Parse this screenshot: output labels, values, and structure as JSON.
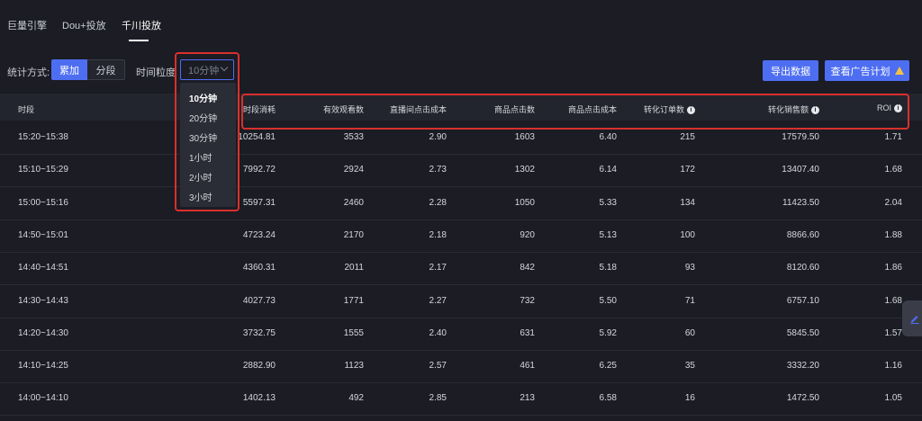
{
  "tabs": [
    {
      "label": "巨量引擎"
    },
    {
      "label": "Dou+投放"
    },
    {
      "label": "千川投放"
    }
  ],
  "controls": {
    "stat_mode_label": "统计方式:",
    "stat_mode_options": [
      "累加",
      "分段"
    ],
    "granularity_label": "时间粒度",
    "granularity_value": "10分钟",
    "granularity_options": [
      "10分钟",
      "20分钟",
      "30分钟",
      "1小时",
      "2小时",
      "3小时"
    ],
    "export_label": "导出数据",
    "view_plan_label": "查看广告计划"
  },
  "table": {
    "headers": [
      "时段",
      "时段消耗",
      "有效观看数",
      "直播间点击成本",
      "商品点击数",
      "商品点击成本",
      "转化订单数",
      "转化销售额",
      "ROI"
    ],
    "info_headers": [
      "转化订单数",
      "转化销售额",
      "ROI"
    ],
    "rows": [
      [
        "15:20~15:38",
        "10254.81",
        "3533",
        "2.90",
        "1603",
        "6.40",
        "215",
        "17579.50",
        "1.71"
      ],
      [
        "15:10~15:29",
        "7992.72",
        "2924",
        "2.73",
        "1302",
        "6.14",
        "172",
        "13407.40",
        "1.68"
      ],
      [
        "15:00~15:16",
        "5597.31",
        "2460",
        "2.28",
        "1050",
        "5.33",
        "134",
        "11423.50",
        "2.04"
      ],
      [
        "14:50~15:01",
        "4723.24",
        "2170",
        "2.18",
        "920",
        "5.13",
        "100",
        "8866.60",
        "1.88"
      ],
      [
        "14:40~14:51",
        "4360.31",
        "2011",
        "2.17",
        "842",
        "5.18",
        "93",
        "8120.60",
        "1.86"
      ],
      [
        "14:30~14:43",
        "4027.73",
        "1771",
        "2.27",
        "732",
        "5.50",
        "71",
        "6757.10",
        "1.68"
      ],
      [
        "14:20~14:30",
        "3732.75",
        "1555",
        "2.40",
        "631",
        "5.92",
        "60",
        "5845.50",
        "1.57"
      ],
      [
        "14:10~14:25",
        "2882.90",
        "1123",
        "2.57",
        "461",
        "6.25",
        "35",
        "3332.20",
        "1.16"
      ],
      [
        "14:00~14:10",
        "1402.13",
        "492",
        "2.85",
        "213",
        "6.58",
        "16",
        "1472.50",
        "1.05"
      ]
    ]
  },
  "colors": {
    "accent": "#4e6ef2",
    "highlight": "#d9302c",
    "warning": "#f5c242",
    "background": "#1b1c24"
  }
}
